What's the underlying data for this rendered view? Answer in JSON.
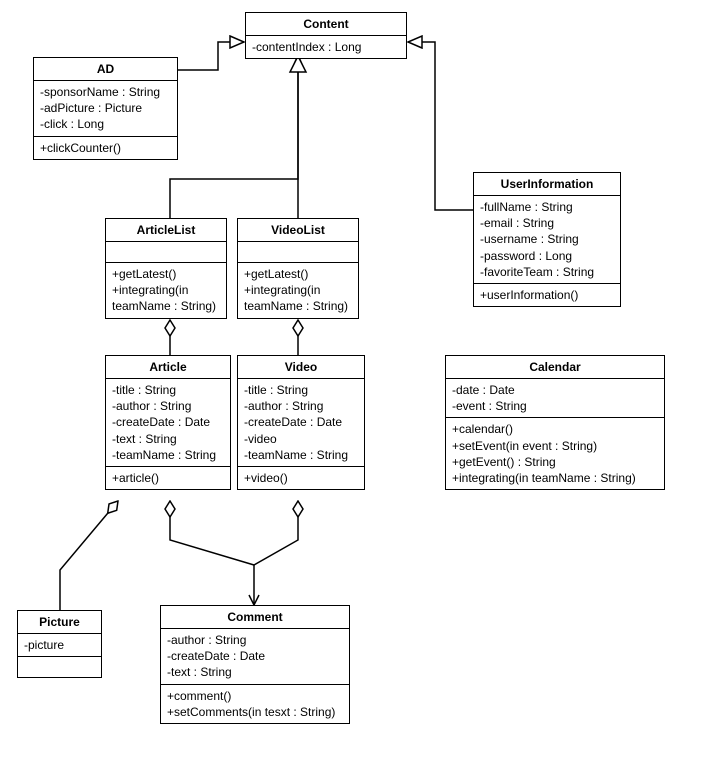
{
  "chart_data": {
    "type": "uml_class_diagram",
    "classes": [
      {
        "name": "Content",
        "attributes": [
          "-contentIndex : Long"
        ],
        "methods": []
      },
      {
        "name": "AD",
        "attributes": [
          "-sponsorName : String",
          "-adPicture : Picture",
          "-click : Long"
        ],
        "methods": [
          "+clickCounter()"
        ]
      },
      {
        "name": "ArticleList",
        "attributes": [],
        "methods": [
          "+getLatest()",
          "+integrating(in teamName : String)"
        ]
      },
      {
        "name": "VideoList",
        "attributes": [],
        "methods": [
          "+getLatest()",
          "+integrating(in teamName : String)"
        ]
      },
      {
        "name": "UserInformation",
        "attributes": [
          "-fullName : String",
          "-email : String",
          "-username : String",
          "-password : Long",
          "-favoriteTeam : String"
        ],
        "methods": [
          "+userInformation()"
        ]
      },
      {
        "name": "Article",
        "attributes": [
          "-title : String",
          "-author : String",
          "-createDate : Date",
          "-text : String",
          "-teamName : String"
        ],
        "methods": [
          "+article()"
        ]
      },
      {
        "name": "Video",
        "attributes": [
          "-title : String",
          "-author : String",
          "-createDate : Date",
          "-video",
          "-teamName : String"
        ],
        "methods": [
          "+video()"
        ]
      },
      {
        "name": "Calendar",
        "attributes": [
          "-date : Date",
          "-event : String"
        ],
        "methods": [
          "+calendar()",
          "+setEvent(in event : String)",
          "+getEvent() : String",
          "+integrating(in teamName : String)"
        ]
      },
      {
        "name": "Picture",
        "attributes": [
          "-picture"
        ],
        "methods": []
      },
      {
        "name": "Comment",
        "attributes": [
          "-author : String",
          "-createDate : Date",
          "-text : String"
        ],
        "methods": [
          "+comment()",
          "+setComments(in tesxt : String)"
        ]
      }
    ],
    "relationships": [
      {
        "type": "generalization",
        "from": "AD",
        "to": "Content"
      },
      {
        "type": "generalization",
        "from": "ArticleList",
        "to": "Content"
      },
      {
        "type": "generalization",
        "from": "VideoList",
        "to": "Content"
      },
      {
        "type": "generalization",
        "from": "UserInformation",
        "to": "Content"
      },
      {
        "type": "aggregation",
        "container": "ArticleList",
        "part": "Article"
      },
      {
        "type": "aggregation",
        "container": "VideoList",
        "part": "Video"
      },
      {
        "type": "aggregation",
        "container": "Article",
        "part": "Picture"
      },
      {
        "type": "aggregation",
        "container": "Article",
        "part": "Comment"
      },
      {
        "type": "aggregation",
        "container": "Video",
        "part": "Comment"
      }
    ]
  },
  "classes": {
    "content": {
      "title": "Content",
      "attr": [
        "-contentIndex : Long"
      ],
      "meth": []
    },
    "ad": {
      "title": "AD",
      "attr": [
        "-sponsorName : String",
        "-adPicture : Picture",
        "-click : Long"
      ],
      "meth": [
        "+clickCounter()"
      ]
    },
    "articleList": {
      "title": "ArticleList",
      "attr": [],
      "meth": [
        "+getLatest()",
        "+integrating(in",
        "teamName : String)"
      ]
    },
    "videoList": {
      "title": "VideoList",
      "attr": [],
      "meth": [
        "+getLatest()",
        "+integrating(in",
        "teamName : String)"
      ]
    },
    "userInfo": {
      "title": "UserInformation",
      "attr": [
        "-fullName : String",
        "-email : String",
        "-username : String",
        "-password : Long",
        "-favoriteTeam : String"
      ],
      "meth": [
        "+userInformation()"
      ]
    },
    "article": {
      "title": "Article",
      "attr": [
        "-title : String",
        "-author : String",
        "-createDate : Date",
        "-text : String",
        "-teamName : String"
      ],
      "meth": [
        "+article()"
      ]
    },
    "video": {
      "title": "Video",
      "attr": [
        "-title : String",
        "-author : String",
        "-createDate : Date",
        "-video",
        "-teamName : String"
      ],
      "meth": [
        "+video()"
      ]
    },
    "calendar": {
      "title": "Calendar",
      "attr": [
        "-date : Date",
        "-event : String"
      ],
      "meth": [
        "+calendar()",
        "+setEvent(in event : String)",
        "+getEvent() : String",
        "+integrating(in teamName : String)"
      ]
    },
    "picture": {
      "title": "Picture",
      "attr": [
        "-picture"
      ],
      "meth": []
    },
    "comment": {
      "title": "Comment",
      "attr": [
        "-author : String",
        "-createDate : Date",
        "-text : String"
      ],
      "meth": [
        "+comment()",
        "+setComments(in tesxt : String)"
      ]
    }
  }
}
